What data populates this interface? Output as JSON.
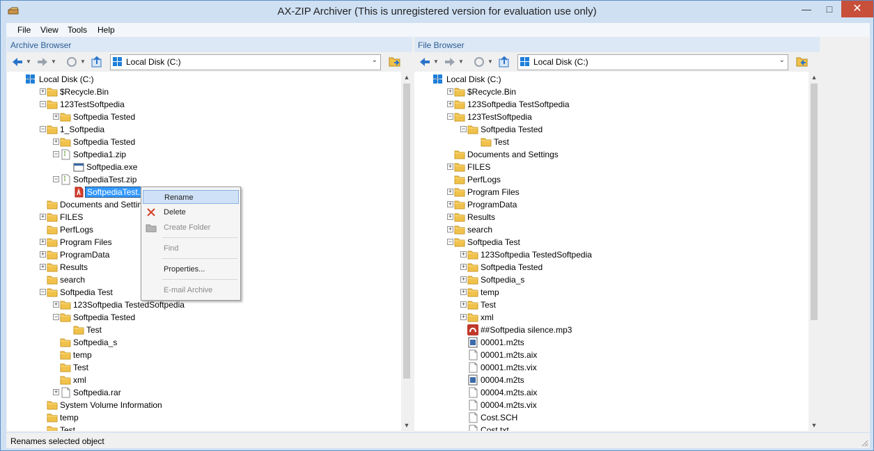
{
  "window": {
    "title": "AX-ZIP Archiver (This is unregistered version for evaluation use only)"
  },
  "menu": [
    "File",
    "View",
    "Tools",
    "Help"
  ],
  "archive_browser": {
    "title": "Archive Browser",
    "location": "Local Disk (C:)",
    "tree": [
      {
        "label": "Local Disk (C:)",
        "level": 0,
        "icon": "drive",
        "expander": "minus"
      },
      {
        "label": "$Recycle.Bin",
        "level": 1,
        "icon": "folder",
        "expander": "plus"
      },
      {
        "label": "123TestSoftpedia",
        "level": 1,
        "icon": "folder",
        "expander": "minus"
      },
      {
        "label": "Softpedia Tested",
        "level": 2,
        "icon": "folder",
        "expander": "plus"
      },
      {
        "label": "1_Softpedia",
        "level": 1,
        "icon": "folder",
        "expander": "minus"
      },
      {
        "label": "Softpedia Tested",
        "level": 2,
        "icon": "folder",
        "expander": "plus"
      },
      {
        "label": "Softpedia1.zip",
        "level": 2,
        "icon": "zip",
        "expander": "minus"
      },
      {
        "label": "Softpedia.exe",
        "level": 3,
        "icon": "exe",
        "expander": ""
      },
      {
        "label": "SoftpediaTest.zip",
        "level": 2,
        "icon": "zip",
        "expander": "minus"
      },
      {
        "label": "SoftpediaTest.pdf",
        "level": 3,
        "icon": "pdf",
        "expander": "",
        "selected": true
      },
      {
        "label": "Documents and Settings",
        "level": 1,
        "icon": "folder",
        "expander": ""
      },
      {
        "label": "FILES",
        "level": 1,
        "icon": "folder",
        "expander": "plus"
      },
      {
        "label": "PerfLogs",
        "level": 1,
        "icon": "folder",
        "expander": ""
      },
      {
        "label": "Program Files",
        "level": 1,
        "icon": "folder",
        "expander": "plus"
      },
      {
        "label": "ProgramData",
        "level": 1,
        "icon": "folder",
        "expander": "plus"
      },
      {
        "label": "Results",
        "level": 1,
        "icon": "folder",
        "expander": "plus"
      },
      {
        "label": "search",
        "level": 1,
        "icon": "folder",
        "expander": ""
      },
      {
        "label": "Softpedia Test",
        "level": 1,
        "icon": "folder",
        "expander": "minus"
      },
      {
        "label": "123Softpedia TestedSoftpedia",
        "level": 2,
        "icon": "folder",
        "expander": "plus"
      },
      {
        "label": "Softpedia Tested",
        "level": 2,
        "icon": "folder",
        "expander": "minus"
      },
      {
        "label": "Test",
        "level": 3,
        "icon": "folder",
        "expander": ""
      },
      {
        "label": "Softpedia_s",
        "level": 2,
        "icon": "folder",
        "expander": ""
      },
      {
        "label": "temp",
        "level": 2,
        "icon": "folder",
        "expander": ""
      },
      {
        "label": "Test",
        "level": 2,
        "icon": "folder",
        "expander": ""
      },
      {
        "label": "xml",
        "level": 2,
        "icon": "folder",
        "expander": ""
      },
      {
        "label": "Softpedia.rar",
        "level": 2,
        "icon": "file",
        "expander": "plus"
      },
      {
        "label": "System Volume Information",
        "level": 1,
        "icon": "folder",
        "expander": ""
      },
      {
        "label": "temp",
        "level": 1,
        "icon": "folder",
        "expander": ""
      },
      {
        "label": "Test",
        "level": 1,
        "icon": "folder",
        "expander": ""
      }
    ]
  },
  "file_browser": {
    "title": "File Browser",
    "location": "Local Disk (C:)",
    "tree": [
      {
        "label": "Local Disk (C:)",
        "level": 0,
        "icon": "drive",
        "expander": "minus"
      },
      {
        "label": "$Recycle.Bin",
        "level": 1,
        "icon": "folder",
        "expander": "plus"
      },
      {
        "label": "123Softpedia TestSoftpedia",
        "level": 1,
        "icon": "folder",
        "expander": "plus"
      },
      {
        "label": "123TestSoftpedia",
        "level": 1,
        "icon": "folder",
        "expander": "minus"
      },
      {
        "label": "Softpedia Tested",
        "level": 2,
        "icon": "folder",
        "expander": "minus"
      },
      {
        "label": "Test",
        "level": 3,
        "icon": "folder",
        "expander": ""
      },
      {
        "label": "Documents and Settings",
        "level": 1,
        "icon": "folder",
        "expander": ""
      },
      {
        "label": "FILES",
        "level": 1,
        "icon": "folder",
        "expander": "plus"
      },
      {
        "label": "PerfLogs",
        "level": 1,
        "icon": "folder",
        "expander": ""
      },
      {
        "label": "Program Files",
        "level": 1,
        "icon": "folder",
        "expander": "plus"
      },
      {
        "label": "ProgramData",
        "level": 1,
        "icon": "folder",
        "expander": "plus"
      },
      {
        "label": "Results",
        "level": 1,
        "icon": "folder",
        "expander": "plus"
      },
      {
        "label": "search",
        "level": 1,
        "icon": "folder",
        "expander": "plus"
      },
      {
        "label": "Softpedia Test",
        "level": 1,
        "icon": "folder",
        "expander": "minus"
      },
      {
        "label": "123Softpedia TestedSoftpedia",
        "level": 2,
        "icon": "folder",
        "expander": "plus"
      },
      {
        "label": "Softpedia Tested",
        "level": 2,
        "icon": "folder",
        "expander": "plus"
      },
      {
        "label": "Softpedia_s",
        "level": 2,
        "icon": "folder",
        "expander": "plus"
      },
      {
        "label": "temp",
        "level": 2,
        "icon": "folder",
        "expander": "plus"
      },
      {
        "label": "Test",
        "level": 2,
        "icon": "folder",
        "expander": "plus"
      },
      {
        "label": "xml",
        "level": 2,
        "icon": "folder",
        "expander": "plus"
      },
      {
        "label": "##Softpedia silence.mp3",
        "level": 2,
        "icon": "audio",
        "expander": ""
      },
      {
        "label": "00001.m2ts",
        "level": 2,
        "icon": "media",
        "expander": ""
      },
      {
        "label": "00001.m2ts.aix",
        "level": 2,
        "icon": "file",
        "expander": ""
      },
      {
        "label": "00001.m2ts.vix",
        "level": 2,
        "icon": "file",
        "expander": ""
      },
      {
        "label": "00004.m2ts",
        "level": 2,
        "icon": "media",
        "expander": ""
      },
      {
        "label": "00004.m2ts.aix",
        "level": 2,
        "icon": "file",
        "expander": ""
      },
      {
        "label": "00004.m2ts.vix",
        "level": 2,
        "icon": "file",
        "expander": ""
      },
      {
        "label": "Cost.SCH",
        "level": 2,
        "icon": "file",
        "expander": ""
      },
      {
        "label": "Cost.txt",
        "level": 2,
        "icon": "file",
        "expander": ""
      }
    ]
  },
  "context_menu": [
    {
      "label": "Rename",
      "icon": "",
      "enabled": true,
      "hover": true
    },
    {
      "label": "Delete",
      "icon": "delete-icon",
      "enabled": true
    },
    {
      "label": "Create Folder",
      "icon": "create-folder-icon",
      "enabled": false
    },
    {
      "label": "Find",
      "icon": "",
      "enabled": false
    },
    {
      "label": "Properties...",
      "icon": "",
      "enabled": true
    },
    {
      "label": "E-mail Archive",
      "icon": "",
      "enabled": false
    }
  ],
  "status": {
    "text": "Renames selected object"
  },
  "colors": {
    "selection": "#3399ff",
    "pane_title": "#2b5b93",
    "folder": "#f1c24b",
    "close": "#c84f3a"
  }
}
